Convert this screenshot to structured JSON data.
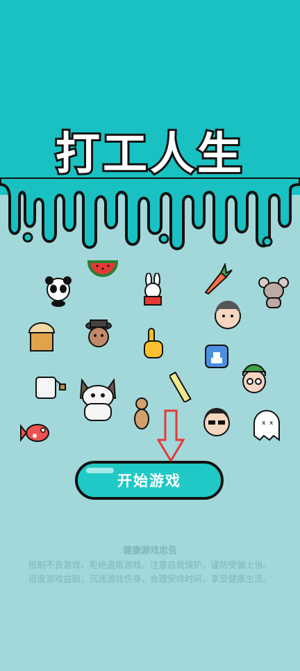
{
  "game": {
    "title": "打工人生",
    "start_button": "开始游戏"
  },
  "health_notice": {
    "title": "健康游戏忠告",
    "line1": "抵制不良游戏，拒绝盗版游戏。注意自我保护，谨防受骗上当。",
    "line2": "适度游戏益脑，沉迷游戏伤身。合理安排时间，享受健康生活。"
  },
  "icons": [
    "panda-icon",
    "watermelon-icon",
    "rabbit-icon",
    "carrot-icon",
    "mouse-icon",
    "cake-cup-icon",
    "man-hat-icon",
    "pointing-hand-icon",
    "old-man-icon",
    "ice-block-icon",
    "tea-bag-icon",
    "cat-icon",
    "ruler-icon",
    "meerkat-icon",
    "man-sunglasses-icon",
    "green-cap-boy-icon",
    "fish-icon",
    "ghost-icon",
    "red-arrow-icon"
  ],
  "colors": {
    "top_band": "#19c1c3",
    "background": "#a3d8da",
    "button": "#20c9c6",
    "notice_text": "#7fb6ba",
    "arrow": "#e53935"
  }
}
